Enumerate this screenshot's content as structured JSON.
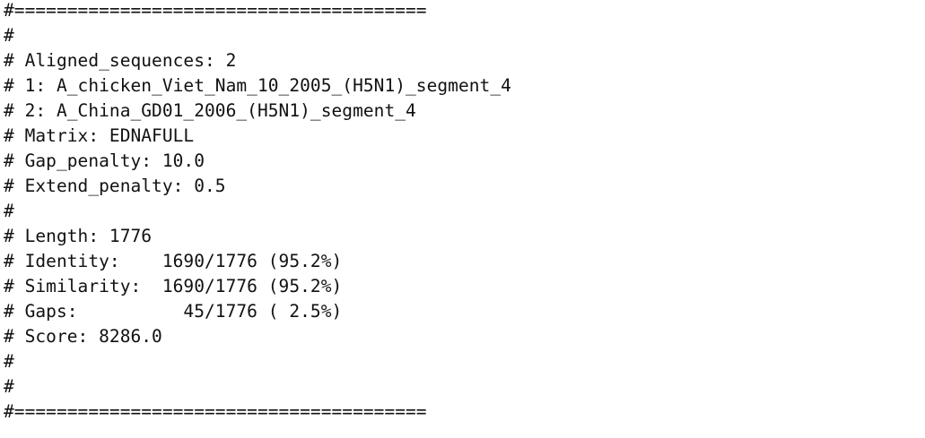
{
  "colors": {
    "background": "#ffffff",
    "text": "#111111"
  },
  "output": {
    "lines": [
      "#=======================================",
      "#",
      "# Aligned_sequences: 2",
      "# 1: A_chicken_Viet_Nam_10_2005_(H5N1)_segment_4",
      "# 2: A_China_GD01_2006_(H5N1)_segment_4",
      "# Matrix: EDNAFULL",
      "# Gap_penalty: 10.0",
      "# Extend_penalty: 0.5",
      "#",
      "# Length: 1776",
      "# Identity:    1690/1776 (95.2%)",
      "# Similarity:  1690/1776 (95.2%)",
      "# Gaps:          45/1776 ( 2.5%)",
      "# Score: 8286.0",
      "#",
      "#",
      "#======================================="
    ]
  }
}
